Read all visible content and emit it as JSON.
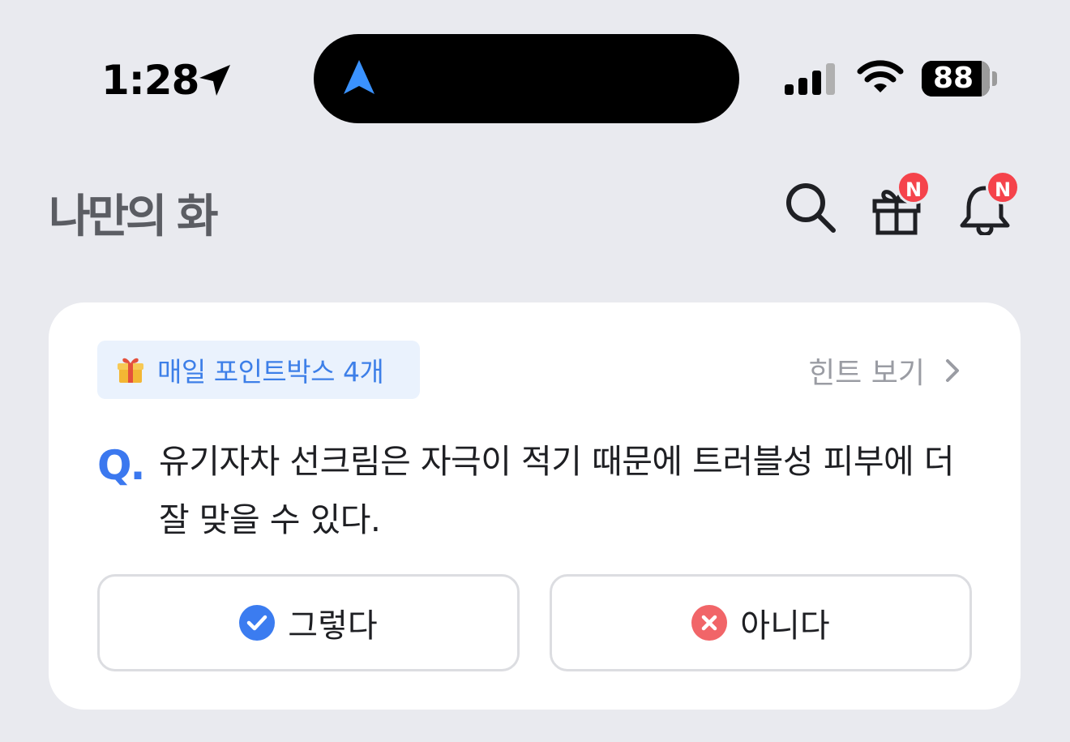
{
  "status_bar": {
    "time": "1:28",
    "battery": "88",
    "battery_level": 0.88
  },
  "header": {
    "logo": "나만의 화",
    "notification_badge": "N",
    "gift_badge": "N"
  },
  "quiz": {
    "pointbox_label": "매일 포인트박스 4개",
    "hint_label": "힌트 보기",
    "q_mark": "Q.",
    "question": "유기자차 선크림은 자극이 적기 때문에 트러블성 피부에 더 잘 맞을 수 있다.",
    "options": [
      {
        "label": "그렇다",
        "icon": "check-circle-icon",
        "color": "#3b7cf0"
      },
      {
        "label": "아니다",
        "icon": "x-circle-icon",
        "color": "#f16568"
      }
    ]
  },
  "colors": {
    "accent": "#3b78ef",
    "badge": "#f5434b",
    "background": "#e9eaef"
  }
}
